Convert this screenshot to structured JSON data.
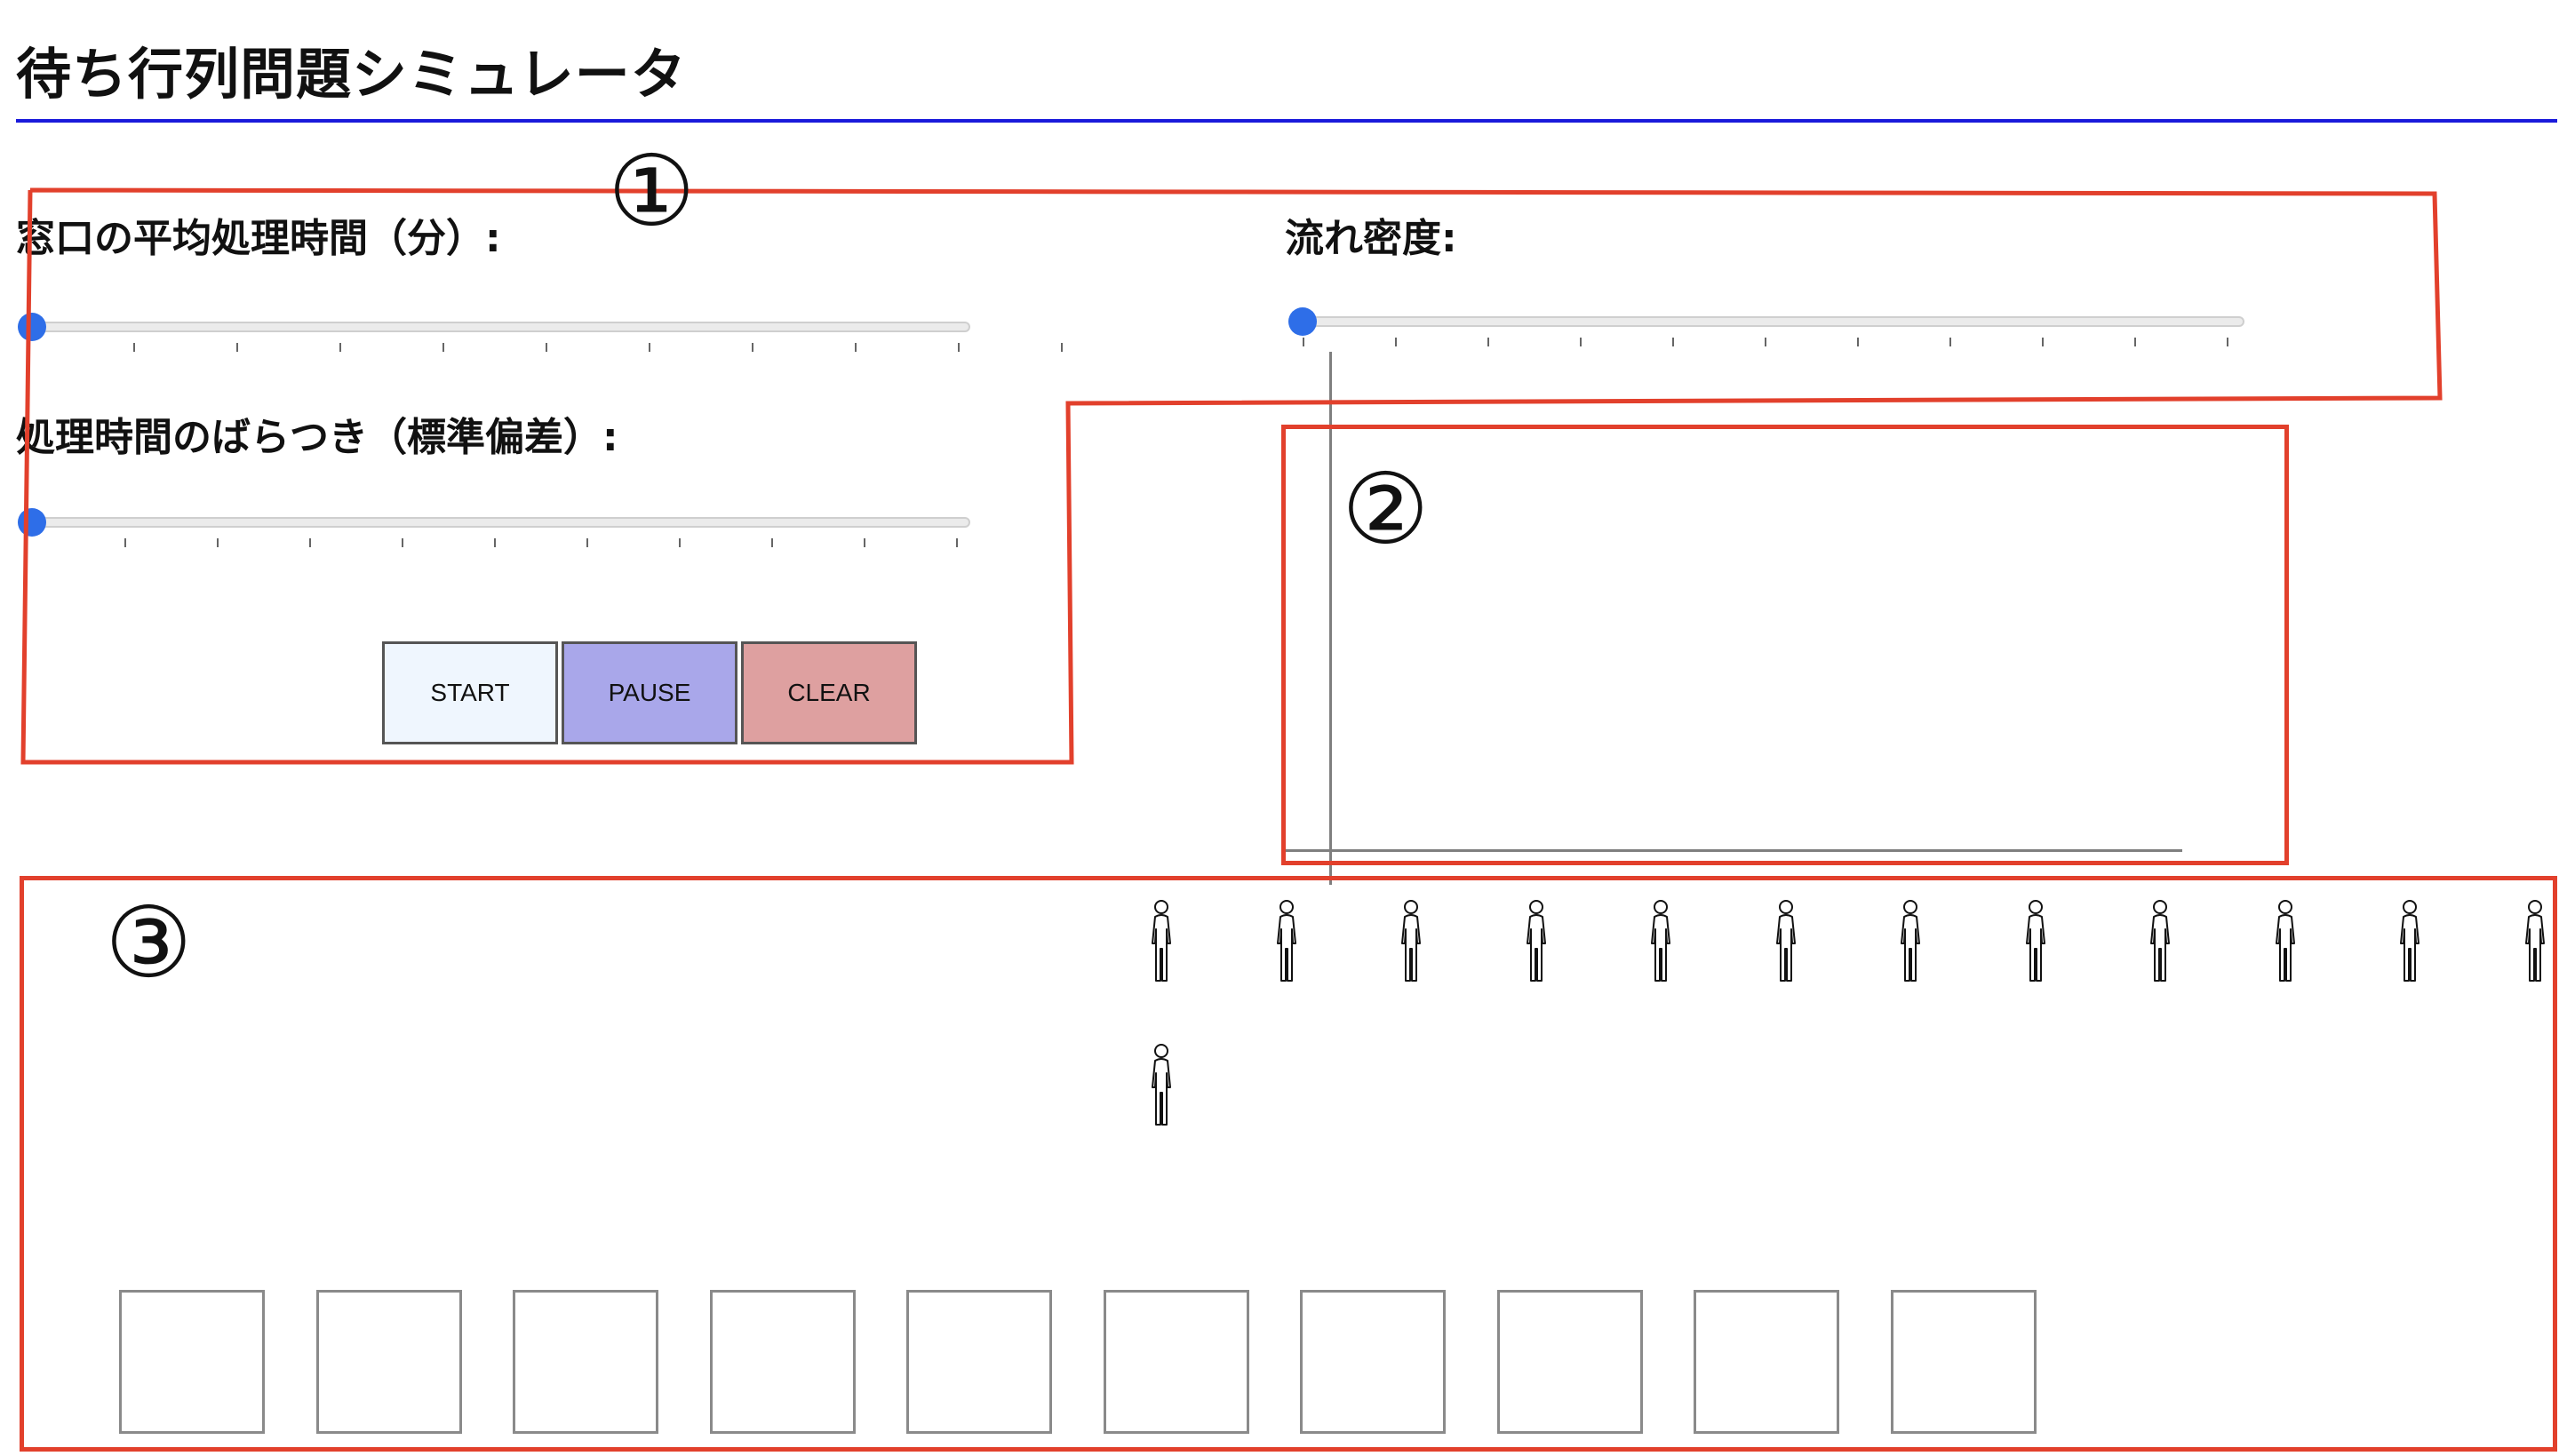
{
  "header": {
    "title": "待ち行列問題シミュレータ"
  },
  "controls": {
    "service_time_label": "窓口の平均処理時間（分）:",
    "service_time_value": 0,
    "variance_label": "処理時間のばらつき（標準偏差）:",
    "variance_value": 0,
    "flow_density_label": "流れ密度:",
    "flow_density_value": 0
  },
  "buttons": {
    "start": "START",
    "pause": "PAUSE",
    "clear": "CLEAR"
  },
  "annotations": {
    "one": "①",
    "two": "②",
    "three": "③"
  },
  "queue": {
    "waiting_top_row": 12,
    "waiting_second_row": 1,
    "window_count": 10
  },
  "colors": {
    "accent": "#2e6ee8",
    "title_rule": "#1a1adb",
    "annotation": "#e2402c",
    "start_button": "#eff6fe",
    "pause_button": "#a9a7ea",
    "clear_button": "#dea0a0"
  }
}
